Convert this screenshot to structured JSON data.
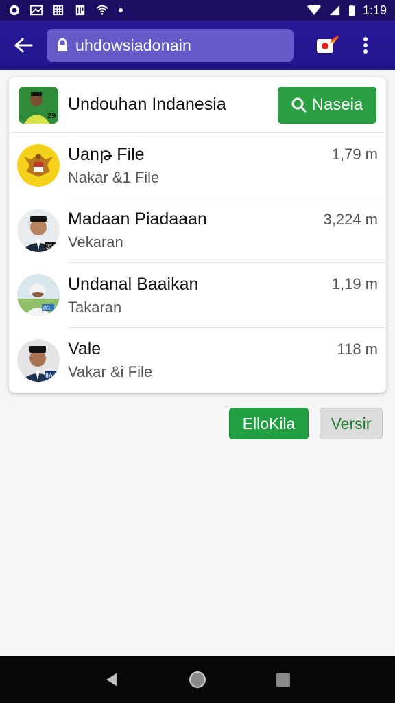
{
  "status_bar": {
    "time": "1:19",
    "icons": [
      "notification-circle-icon",
      "mail-icon",
      "grid-icon",
      "sim-icon",
      "wifi-icon",
      "dot-icon",
      "signal-icon",
      "battery-icon"
    ]
  },
  "toolbar": {
    "url": "uhdowsiadonain",
    "icons": [
      "back-arrow-icon",
      "lock-icon",
      "extension-icon",
      "more-vert-icon"
    ]
  },
  "card": {
    "header": {
      "title": "Undouhan Indanesia",
      "search_label": "Naseia"
    },
    "items": [
      {
        "title": "Uanթ File",
        "subtitle": "Nakar &1 File",
        "size": "1,79 m"
      },
      {
        "title": "Madaan Piadaaan",
        "subtitle": "Vekaran",
        "size": "3,224 m"
      },
      {
        "title": "Undanal Baaikan",
        "subtitle": "Takaran",
        "size": "1,19 m"
      },
      {
        "title": "Vale",
        "subtitle": "Vakar &i File",
        "size": "118 m"
      }
    ]
  },
  "actions": {
    "primary_label": "ElloKila",
    "secondary_label": "Versir"
  },
  "colors": {
    "status_bar": "#1c0f63",
    "toolbar": "#2a189a",
    "urlbar": "#6659c8",
    "accent_green": "#21a043"
  }
}
